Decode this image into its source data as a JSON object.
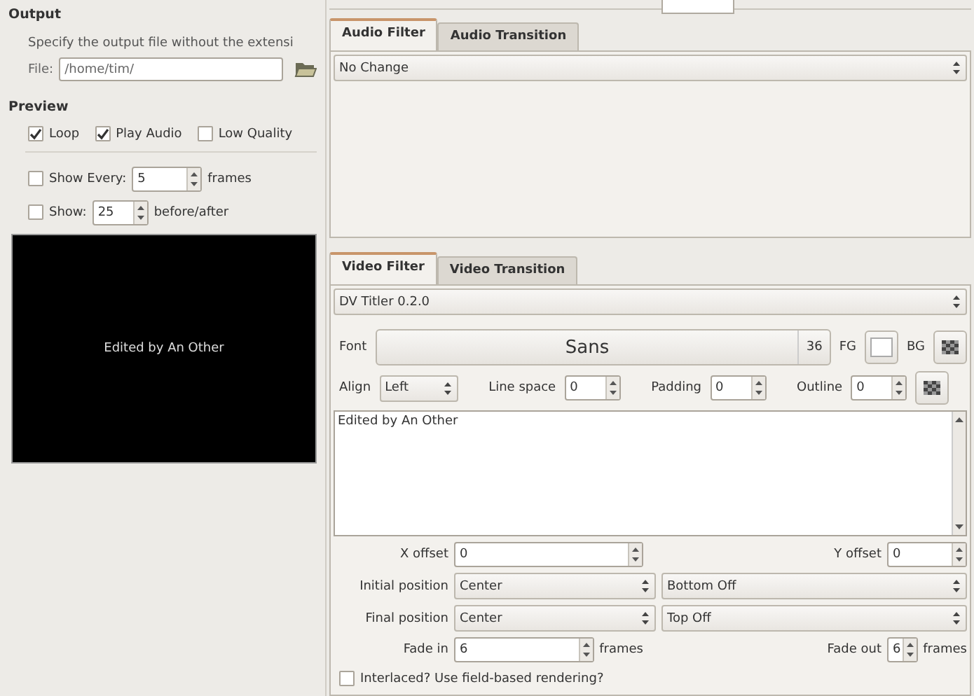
{
  "output": {
    "heading": "Output",
    "hint": "Specify the output file without the extensi",
    "file_label": "File:",
    "file_value": "/home/tim/"
  },
  "preview": {
    "heading": "Preview",
    "options": [
      {
        "label": "Loop",
        "checked": true
      },
      {
        "label": "Play Audio",
        "checked": true
      },
      {
        "label": "Low Quality",
        "checked": false
      }
    ],
    "spins": [
      {
        "label": "Show Every:",
        "checked": false,
        "value": "5",
        "unit": "frames"
      },
      {
        "label": "Show:",
        "checked": false,
        "value": "25",
        "unit": "before/after"
      }
    ],
    "caption": "Edited by An Other"
  },
  "audio": {
    "tabs": [
      {
        "label": "Audio Filter",
        "selected": true
      },
      {
        "label": "Audio Transition",
        "selected": false
      }
    ],
    "filter": "No Change"
  },
  "video": {
    "tabs": [
      {
        "label": "Video Filter",
        "selected": true
      },
      {
        "label": "Video Transition",
        "selected": false
      }
    ],
    "filter": "DV Titler 0.2.0",
    "font_label": "Font",
    "font": "Sans",
    "font_size": "36",
    "fg_label": "FG",
    "bg_label": "BG",
    "align_label": "Align",
    "align": "Left",
    "spins": [
      {
        "label": "Line space",
        "value": "0"
      },
      {
        "label": "Padding",
        "value": "0"
      },
      {
        "label": "Outline",
        "value": "0"
      }
    ],
    "text": "Edited by An Other",
    "x_offset": {
      "label": "X offset",
      "value": "0"
    },
    "y_offset": {
      "label": "Y offset",
      "value": "0"
    },
    "initial": {
      "label": "Initial position",
      "x": "Center",
      "y": "Bottom Off"
    },
    "final": {
      "label": "Final position",
      "x": "Center",
      "y": "Top Off"
    },
    "fade_in": {
      "label": "Fade in",
      "value": "6",
      "unit": "frames"
    },
    "fade_out": {
      "label": "Fade out",
      "value": "6",
      "unit": "frames"
    },
    "interlaced": {
      "label": "Interlaced? Use field-based rendering?",
      "checked": false
    }
  }
}
